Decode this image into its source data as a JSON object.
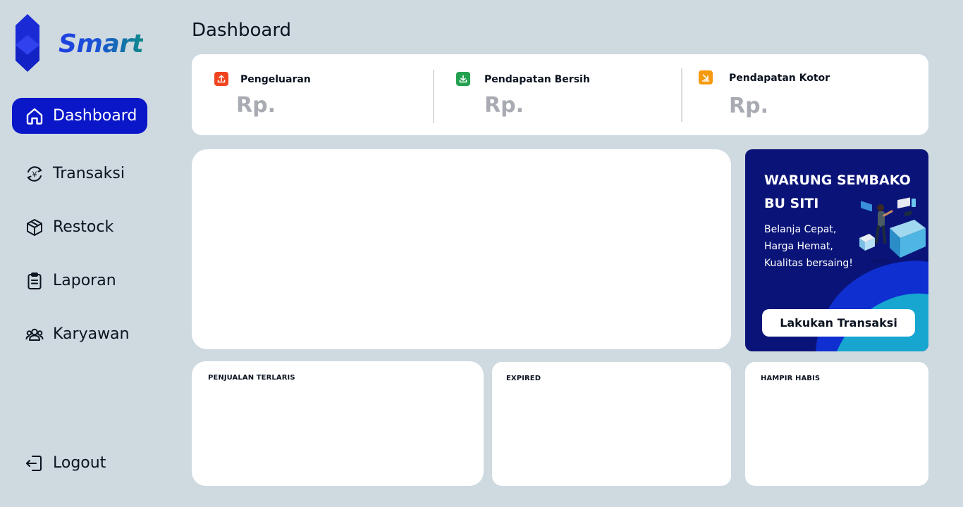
{
  "brand": {
    "name": "Smart"
  },
  "sidebar": {
    "items": [
      {
        "label": "Dashboard",
        "icon": "home-icon",
        "active": true
      },
      {
        "label": "Transaksi",
        "icon": "currency-exchange-icon",
        "active": false
      },
      {
        "label": "Restock",
        "icon": "package-icon",
        "active": false
      },
      {
        "label": "Laporan",
        "icon": "clipboard-icon",
        "active": false
      },
      {
        "label": "Karyawan",
        "icon": "users-icon",
        "active": false
      }
    ],
    "logout": {
      "label": "Logout",
      "icon": "logout-icon"
    }
  },
  "page": {
    "title": "Dashboard"
  },
  "stats": [
    {
      "label": "Pengeluaran",
      "value": "Rp.",
      "icon": "arrow-up-tray-icon",
      "color": "#f0441f"
    },
    {
      "label": "Pendapatan Bersih",
      "value": "Rp.",
      "icon": "arrow-down-tray-icon",
      "color": "#23a04f"
    },
    {
      "label": "Pendapatan Kotor",
      "value": "Rp.",
      "icon": "arrow-down-right-icon",
      "color": "#f59a0c"
    }
  ],
  "promo": {
    "title": "WARUNG SEMBAKO BU SITI",
    "subtitle": "Belanja Cepat, Harga Hemat, Kualitas bersaing!",
    "button_label": "Lakukan Transaksi"
  },
  "lists": {
    "best_selling": {
      "title": "PENJUALAN TERLARIS"
    },
    "expired": {
      "title": "EXPIRED"
    },
    "low_stock": {
      "title": "HAMPIR HABIS"
    }
  },
  "colors": {
    "background": "#cfd9e0",
    "accent": "#0a17c9",
    "promo_bg": "#0a1478"
  }
}
